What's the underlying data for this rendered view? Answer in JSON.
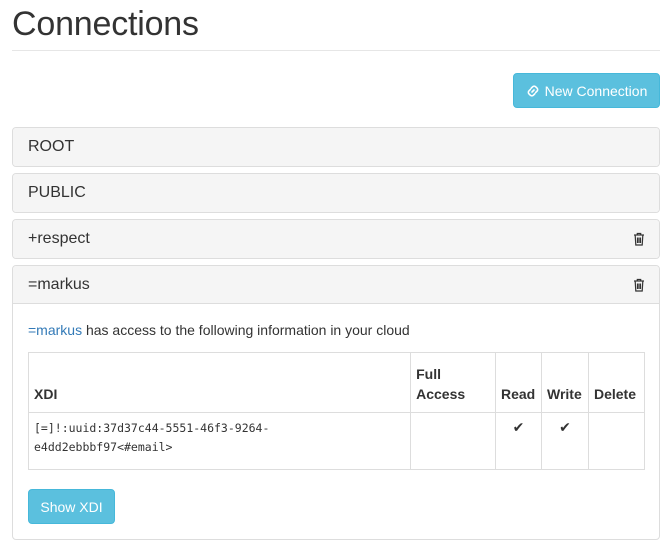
{
  "header": {
    "title": "Connections"
  },
  "toolbar": {
    "new_connection_label": "New Connection"
  },
  "connections": [
    {
      "name": "ROOT",
      "deletable": false,
      "expanded": false
    },
    {
      "name": "PUBLIC",
      "deletable": false,
      "expanded": false
    },
    {
      "name": "+respect",
      "deletable": true,
      "expanded": false
    },
    {
      "name": "=markus",
      "deletable": true,
      "expanded": true
    }
  ],
  "detail": {
    "who": "=markus",
    "access_text": " has access to the following information in your cloud",
    "table": {
      "headers": {
        "xdi": "XDI",
        "full_access": "Full Access",
        "read": "Read",
        "write": "Write",
        "delete": "Delete"
      },
      "rows": [
        {
          "xdi": "[=]!:uuid:37d37c44-5551-46f3-9264-e4dd2ebbbf97<#email>",
          "full_access": "",
          "read": "✔",
          "write": "✔",
          "delete": ""
        }
      ]
    },
    "show_xdi_label": "Show XDI"
  },
  "colors": {
    "accent": "#5bc0de",
    "link": "#337ab7",
    "panel_heading_bg": "#f5f5f5",
    "border": "#dddddd"
  },
  "icons": {
    "link": "link-icon",
    "trash": "trash-icon",
    "check": "check-icon"
  }
}
